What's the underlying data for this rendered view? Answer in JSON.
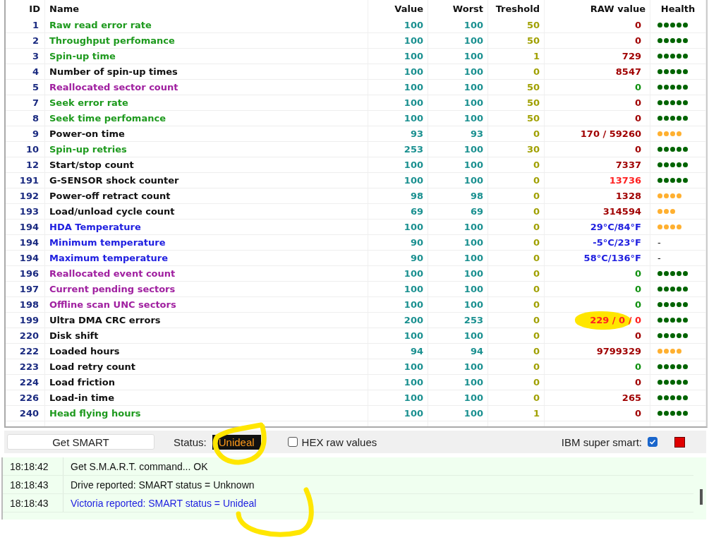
{
  "table": {
    "columns": [
      "ID",
      "Name",
      "Value",
      "Worst",
      "Treshold",
      "RAW value",
      "Health"
    ],
    "rows": [
      {
        "id": "1",
        "name": "Raw read error rate",
        "color": "#1e9a1e",
        "value": "100",
        "worst": "100",
        "threshold": "50",
        "raw": {
          "text": "0",
          "color": "#a00000"
        },
        "stars": 5
      },
      {
        "id": "2",
        "name": "Throughput perfomance",
        "color": "#1e9a1e",
        "value": "100",
        "worst": "100",
        "threshold": "50",
        "raw": {
          "text": "0",
          "color": "#a00000"
        },
        "stars": 5
      },
      {
        "id": "3",
        "name": "Spin-up time",
        "color": "#1e9a1e",
        "value": "100",
        "worst": "100",
        "threshold": "1",
        "raw": {
          "text": "729",
          "color": "#a00000"
        },
        "stars": 5
      },
      {
        "id": "4",
        "name": "Number of spin-up times",
        "color": "#111111",
        "value": "100",
        "worst": "100",
        "threshold": "0",
        "raw": {
          "text": "8547",
          "color": "#a00000"
        },
        "stars": 5
      },
      {
        "id": "5",
        "name": "Reallocated sector count",
        "color": "#a020a0",
        "value": "100",
        "worst": "100",
        "threshold": "50",
        "raw": {
          "text": "0",
          "color": "#109010"
        },
        "stars": 5
      },
      {
        "id": "7",
        "name": "Seek error rate",
        "color": "#1e9a1e",
        "value": "100",
        "worst": "100",
        "threshold": "50",
        "raw": {
          "text": "0",
          "color": "#a00000"
        },
        "stars": 5
      },
      {
        "id": "8",
        "name": "Seek time perfomance",
        "color": "#1e9a1e",
        "value": "100",
        "worst": "100",
        "threshold": "50",
        "raw": {
          "text": "0",
          "color": "#a00000"
        },
        "stars": 5
      },
      {
        "id": "9",
        "name": "Power-on time",
        "color": "#111111",
        "value": "93",
        "worst": "93",
        "threshold": "0",
        "raw": {
          "text": "170 / 59260",
          "color": "#a00000"
        },
        "stars": 4
      },
      {
        "id": "10",
        "name": "Spin-up retries",
        "color": "#1e9a1e",
        "value": "253",
        "worst": "100",
        "threshold": "30",
        "raw": {
          "text": "0",
          "color": "#a00000"
        },
        "stars": 5
      },
      {
        "id": "12",
        "name": "Start/stop count",
        "color": "#111111",
        "value": "100",
        "worst": "100",
        "threshold": "0",
        "raw": {
          "text": "7337",
          "color": "#a00000"
        },
        "stars": 5
      },
      {
        "id": "191",
        "name": "G-SENSOR shock counter",
        "color": "#111111",
        "value": "100",
        "worst": "100",
        "threshold": "0",
        "raw": {
          "text": "13736",
          "color": "#ff2020"
        },
        "stars": 5
      },
      {
        "id": "192",
        "name": "Power-off retract count",
        "color": "#111111",
        "value": "98",
        "worst": "98",
        "threshold": "0",
        "raw": {
          "text": "1328",
          "color": "#a00000"
        },
        "stars": 4
      },
      {
        "id": "193",
        "name": "Load/unload cycle count",
        "color": "#111111",
        "value": "69",
        "worst": "69",
        "threshold": "0",
        "raw": {
          "text": "314594",
          "color": "#a00000"
        },
        "stars": 3
      },
      {
        "id": "194",
        "name": "HDA Temperature",
        "color": "#2020e0",
        "value": "100",
        "worst": "100",
        "threshold": "0",
        "raw": {
          "text": "29°C/84°F",
          "color": "#2020e0"
        },
        "stars": 4
      },
      {
        "id": "194",
        "name": "Minimum temperature",
        "color": "#2020e0",
        "value": "90",
        "worst": "100",
        "threshold": "0",
        "raw": {
          "text": "-5°C/23°F",
          "color": "#2020e0"
        },
        "health": "-"
      },
      {
        "id": "194",
        "name": "Maximum temperature",
        "color": "#2020e0",
        "value": "90",
        "worst": "100",
        "threshold": "0",
        "raw": {
          "text": "58°C/136°F",
          "color": "#2020e0"
        },
        "health": "-"
      },
      {
        "id": "196",
        "name": "Reallocated event count",
        "color": "#a020a0",
        "value": "100",
        "worst": "100",
        "threshold": "0",
        "raw": {
          "text": "0",
          "color": "#109010"
        },
        "stars": 5
      },
      {
        "id": "197",
        "name": "Current pending sectors",
        "color": "#a020a0",
        "value": "100",
        "worst": "100",
        "threshold": "0",
        "raw": {
          "text": "0",
          "color": "#109010"
        },
        "stars": 5
      },
      {
        "id": "198",
        "name": "Offline scan UNC sectors",
        "color": "#a020a0",
        "value": "100",
        "worst": "100",
        "threshold": "0",
        "raw": {
          "text": "0",
          "color": "#109010"
        },
        "stars": 5
      },
      {
        "id": "199",
        "name": "Ultra DMA CRC errors",
        "color": "#111111",
        "value": "200",
        "worst": "253",
        "threshold": "0",
        "raw": {
          "text": "229 / 0 / 0",
          "color": "#ff2020"
        },
        "stars": 5,
        "highlighted": true
      },
      {
        "id": "220",
        "name": "Disk shift",
        "color": "#111111",
        "value": "100",
        "worst": "100",
        "threshold": "0",
        "raw": {
          "text": "0",
          "color": "#a00000"
        },
        "stars": 5
      },
      {
        "id": "222",
        "name": "Loaded hours",
        "color": "#111111",
        "value": "94",
        "worst": "94",
        "threshold": "0",
        "raw": {
          "text": "9799329",
          "color": "#a00000"
        },
        "stars": 4
      },
      {
        "id": "223",
        "name": "Load retry count",
        "color": "#111111",
        "value": "100",
        "worst": "100",
        "threshold": "0",
        "raw": {
          "text": "0",
          "color": "#109010"
        },
        "stars": 5
      },
      {
        "id": "224",
        "name": "Load friction",
        "color": "#111111",
        "value": "100",
        "worst": "100",
        "threshold": "0",
        "raw": {
          "text": "0",
          "color": "#a00000"
        },
        "stars": 5
      },
      {
        "id": "226",
        "name": "Load-in time",
        "color": "#111111",
        "value": "100",
        "worst": "100",
        "threshold": "0",
        "raw": {
          "text": "265",
          "color": "#a00000"
        },
        "stars": 5
      },
      {
        "id": "240",
        "name": "Head flying hours",
        "color": "#1e9a1e",
        "value": "100",
        "worst": "100",
        "threshold": "1",
        "raw": {
          "text": "0",
          "color": "#a00000"
        },
        "stars": 5
      }
    ]
  },
  "toolbar": {
    "button": "Get SMART",
    "status_label": "Status:",
    "status": "Unideal",
    "status_circled": true,
    "hex": {
      "label": "HEX raw values",
      "checked": false
    },
    "ibm": {
      "label": "IBM super smart:",
      "checked": true
    }
  },
  "log": [
    {
      "time": "18:18:42",
      "message": "Get S.M.A.R.T. command... OK",
      "color": "#111111"
    },
    {
      "time": "18:18:43",
      "message": "Drive reported: SMART status = Unknown",
      "color": "#111111"
    },
    {
      "time": "18:18:43",
      "message": "Victoria reported: SMART status = Unideal",
      "color": "#2020e0",
      "circled": true
    }
  ]
}
